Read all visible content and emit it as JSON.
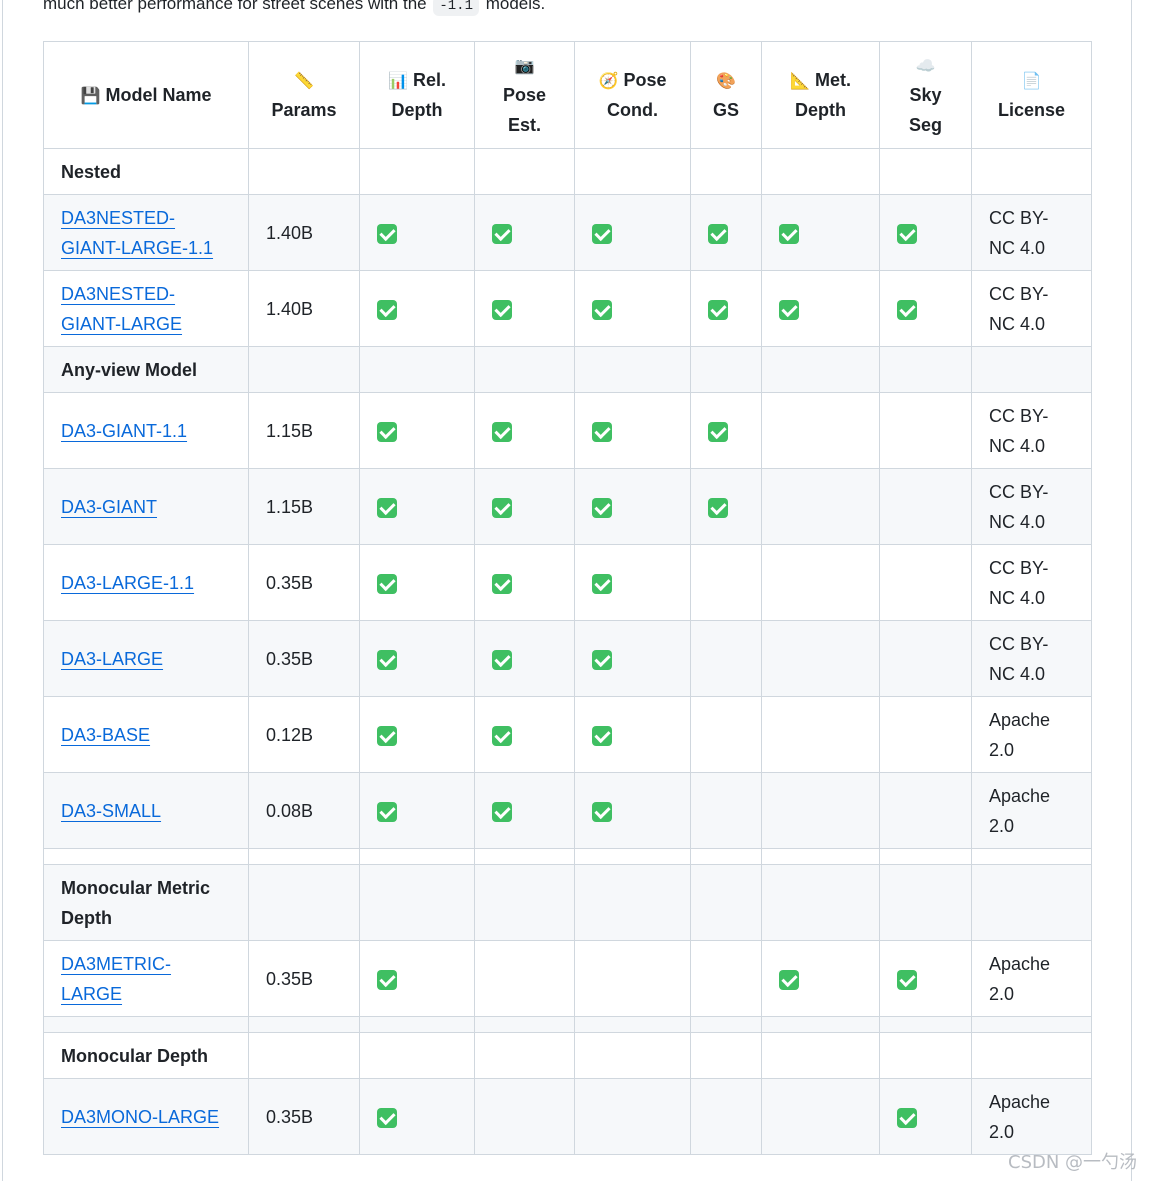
{
  "intro": {
    "text_before": "much better performance for street scenes with the",
    "code": "-1.1",
    "text_after": "models."
  },
  "header": {
    "model_name": {
      "icon": "floppy-disk-icon",
      "glyph": "💾",
      "label": "Model Name"
    },
    "params": {
      "icon": "ruler-icon",
      "glyph": "📏",
      "label": "Params"
    },
    "rel_depth": {
      "icon": "bar-chart-icon",
      "glyph": "📊",
      "label_line1": "Rel.",
      "label_line2": "Depth"
    },
    "pose_est": {
      "icon": "camera-icon",
      "glyph": "📷",
      "label_line1": "Pose",
      "label_line2": "Est."
    },
    "pose_cond": {
      "icon": "compass-icon",
      "glyph": "🧭",
      "label_line1": "Pose",
      "label_line2": "Cond."
    },
    "gs": {
      "icon": "palette-icon",
      "glyph": "🎨",
      "label": "GS"
    },
    "met_depth": {
      "icon": "triangular-ruler-icon",
      "glyph": "📐",
      "label_line1": "Met.",
      "label_line2": "Depth"
    },
    "sky_seg": {
      "icon": "cloud-icon",
      "glyph": "☁️",
      "label_line1": "Sky",
      "label_line2": "Seg"
    },
    "license": {
      "icon": "document-icon",
      "glyph": "📄",
      "label": "License"
    }
  },
  "sections": {
    "nested": "Nested",
    "any_view": "Any-view Model",
    "mono_metric_line1": "Monocular Metric",
    "mono_metric_line2": "Depth",
    "mono_depth": "Monocular Depth"
  },
  "rows": [
    {
      "name": "DA3NESTED-GIANT-LARGE-1.1",
      "name_line1": "DA3NESTED-",
      "name_line2": "GIANT-LARGE-1.1",
      "params": "1.40B",
      "license_line1": "CC BY-",
      "license_line2": "NC 4.0"
    },
    {
      "name": "DA3NESTED-GIANT-LARGE",
      "name_line1": "DA3NESTED-",
      "name_line2": "GIANT-LARGE",
      "params": "1.40B",
      "license_line1": "CC BY-",
      "license_line2": "NC 4.0"
    },
    {
      "name": "DA3-GIANT-1.1",
      "params": "1.15B",
      "license_line1": "CC BY-",
      "license_line2": "NC 4.0"
    },
    {
      "name": "DA3-GIANT",
      "params": "1.15B",
      "license_line1": "CC BY-",
      "license_line2": "NC 4.0"
    },
    {
      "name": "DA3-LARGE-1.1",
      "params": "0.35B",
      "license_line1": "CC BY-",
      "license_line2": "NC 4.0"
    },
    {
      "name": "DA3-LARGE",
      "params": "0.35B",
      "license_line1": "CC BY-",
      "license_line2": "NC 4.0"
    },
    {
      "name": "DA3-BASE",
      "params": "0.12B",
      "license_line1": "Apache",
      "license_line2": "2.0"
    },
    {
      "name": "DA3-SMALL",
      "params": "0.08B",
      "license_line1": "Apache",
      "license_line2": "2.0"
    },
    {
      "name": "DA3METRIC-LARGE",
      "params": "0.35B",
      "license_line1": "Apache",
      "license_line2": "2.0"
    },
    {
      "name": "DA3MONO-LARGE",
      "params": "0.35B",
      "license_line1": "Apache",
      "license_line2": "2.0"
    }
  ],
  "watermark": "CSDN @一勺汤"
}
